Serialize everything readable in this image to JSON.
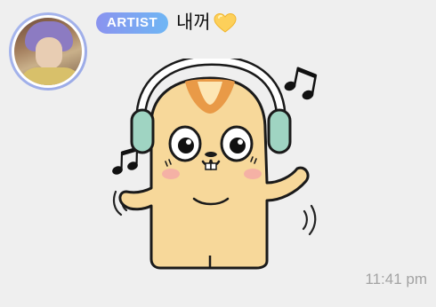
{
  "message": {
    "avatar_icon": "profile-photo",
    "badge_label": "ARTIST",
    "sender_name": "내꺼",
    "name_emoji": "yellow-heart-icon",
    "sticker": "hamster-with-headphones-sticker",
    "timestamp": "11:41 pm"
  },
  "colors": {
    "background": "#efefef",
    "badge_start": "#8a93ef",
    "badge_end": "#6fb6f4",
    "avatar_ring": "#a9b8ee",
    "timestamp": "#a3a3a3"
  }
}
